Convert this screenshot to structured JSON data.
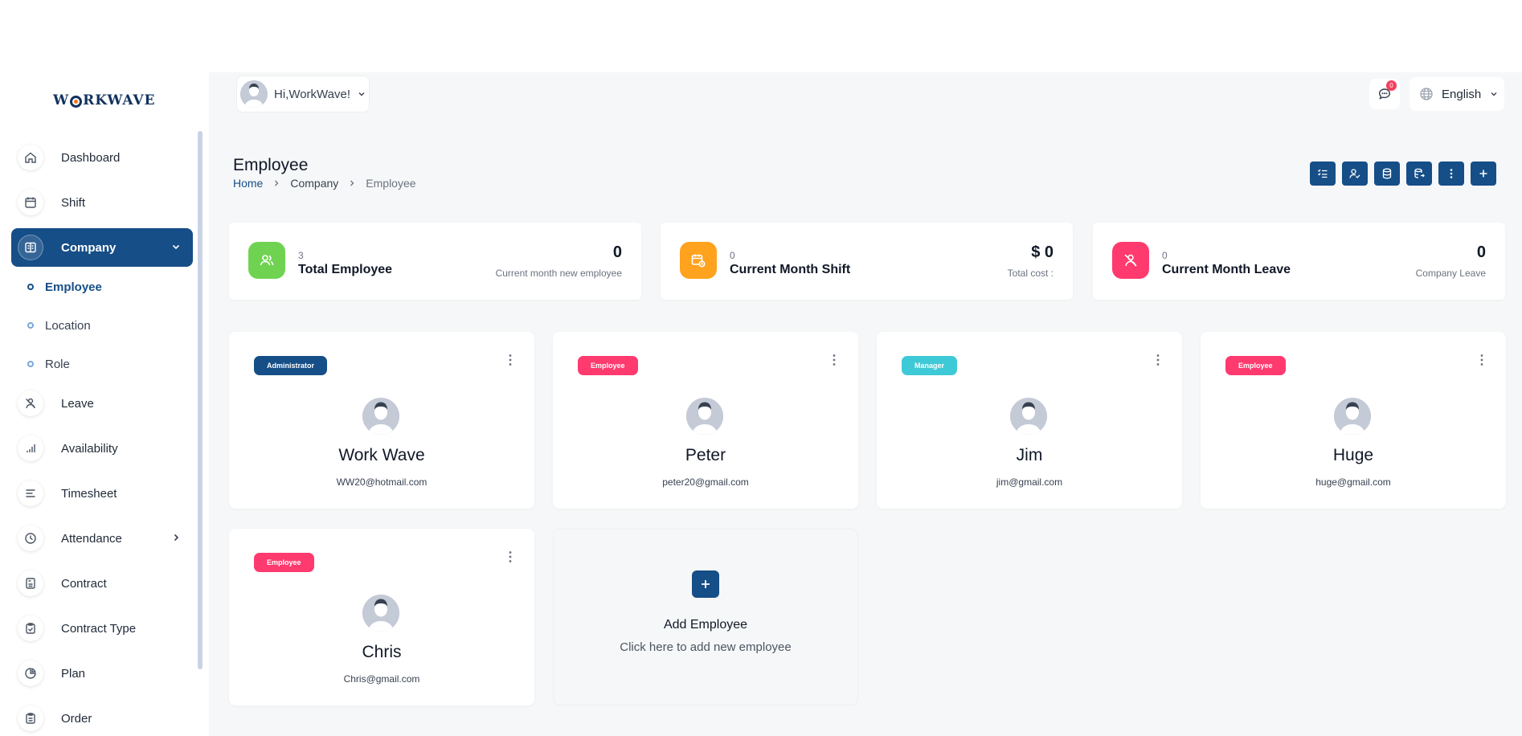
{
  "brand": {
    "logo_text_1": "W",
    "logo_text_2": "RKWAVE"
  },
  "sidebar": {
    "items": [
      {
        "label": "Dashboard",
        "icon": "home-icon"
      },
      {
        "label": "Shift",
        "icon": "calendar-icon"
      },
      {
        "label": "Company",
        "icon": "building-icon"
      },
      {
        "label": "Leave",
        "icon": "leave-icon"
      },
      {
        "label": "Availability",
        "icon": "bars-icon"
      },
      {
        "label": "Timesheet",
        "icon": "lines-icon"
      },
      {
        "label": "Attendance",
        "icon": "clock-icon"
      },
      {
        "label": "Contract",
        "icon": "file-icon"
      },
      {
        "label": "Contract Type",
        "icon": "clipboard-icon"
      },
      {
        "label": "Plan",
        "icon": "pie-icon"
      },
      {
        "label": "Order",
        "icon": "receipt-icon"
      }
    ],
    "company_sub": [
      {
        "label": "Employee"
      },
      {
        "label": "Location"
      },
      {
        "label": "Role"
      }
    ]
  },
  "header": {
    "greeting": "Hi,WorkWave!",
    "chat_count": "0",
    "language": "English"
  },
  "page": {
    "title": "Employee",
    "breadcrumb": [
      "Home",
      "Company",
      "Employee"
    ]
  },
  "stats": [
    {
      "count": "3",
      "title": "Total Employee",
      "value": "0",
      "sub": "Current month new employee",
      "color": "#6fd351"
    },
    {
      "count": "0",
      "title": "Current Month Shift",
      "value": "$ 0",
      "sub": "Total cost :",
      "color": "#ffa21d"
    },
    {
      "count": "0",
      "title": "Current Month Leave",
      "value": "0",
      "sub": "Company Leave",
      "color": "#ff3a6e"
    }
  ],
  "employees": [
    {
      "role": "Administrator",
      "name": "Work Wave",
      "email": "WW20@hotmail.com",
      "role_color": "#164e87"
    },
    {
      "role": "Employee",
      "name": "Peter",
      "email": "peter20@gmail.com",
      "role_color": "#ff3a6e"
    },
    {
      "role": "Manager",
      "name": "Jim",
      "email": "jim@gmail.com",
      "role_color": "#3ec9d6"
    },
    {
      "role": "Employee",
      "name": "Huge",
      "email": "huge@gmail.com",
      "role_color": "#ff3a6e"
    },
    {
      "role": "Employee",
      "name": "Chris",
      "email": "Chris@gmail.com",
      "role_color": "#ff3a6e"
    }
  ],
  "add_card": {
    "title": "Add Employee",
    "subtitle": "Click here to add new employee"
  },
  "colors": {
    "primary": "#164e87"
  }
}
